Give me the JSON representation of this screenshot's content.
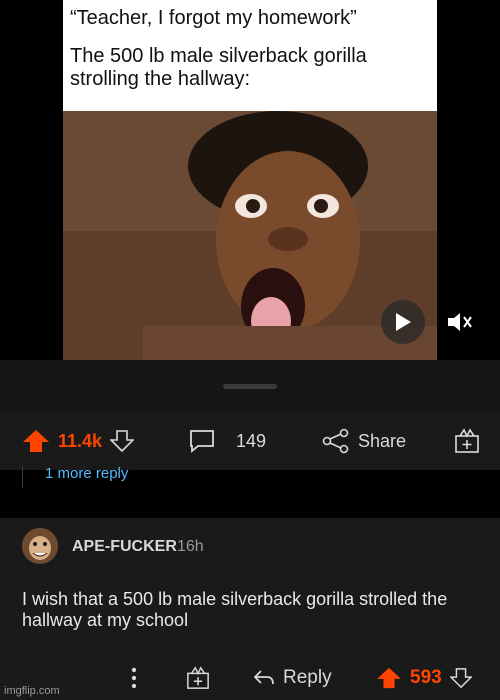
{
  "meme": {
    "line1": "“Teacher, I forgot my homework”",
    "line2": "The 500 lb male silverback gorilla",
    "line3": "strolling the hallway:"
  },
  "post_actions": {
    "upvotes": "11.4k",
    "comments": "149",
    "share_label": "Share"
  },
  "thread": {
    "more_reply": "1 more reply"
  },
  "comment": {
    "author": "APE-FUCKER",
    "age": "16h",
    "text": "I wish that a 500 lb male silverback gorilla strolled the hallway at my school",
    "reply_label": "Reply",
    "score": "593"
  },
  "watermark": "imgflip.com",
  "colors": {
    "upvote": "#ff4500",
    "link": "#4fbcff",
    "background": "#1a1a1b"
  }
}
